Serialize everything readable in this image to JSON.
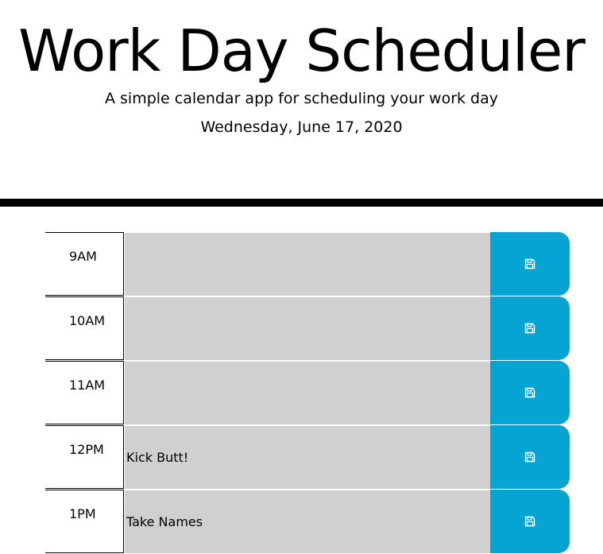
{
  "header": {
    "title": "Work Day Scheduler",
    "subtitle": "A simple calendar app for scheduling your work day",
    "current_day": "Wednesday, June 17, 2020"
  },
  "schedule": {
    "rows": [
      {
        "hour": "9AM",
        "task": "",
        "save_icon": "save-icon"
      },
      {
        "hour": "10AM",
        "task": "",
        "save_icon": "save-icon"
      },
      {
        "hour": "11AM",
        "task": "",
        "save_icon": "save-icon"
      },
      {
        "hour": "12PM",
        "task": "Kick Butt!",
        "save_icon": "save-icon"
      },
      {
        "hour": "1PM",
        "task": "Take Names",
        "save_icon": "save-icon"
      }
    ]
  },
  "colors": {
    "past": "#d0d0d0",
    "save_button": "#06a4d2",
    "divider": "#000000"
  }
}
